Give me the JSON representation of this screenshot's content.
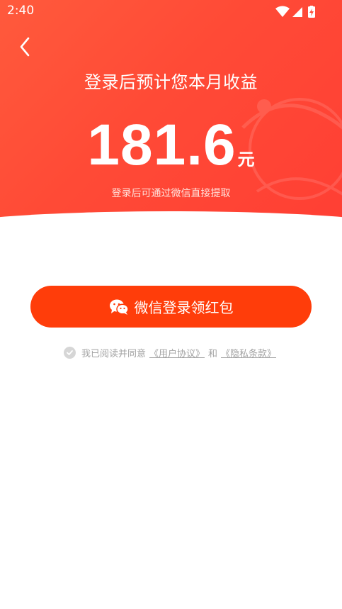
{
  "status_bar": {
    "time": "2:40"
  },
  "hero": {
    "headline": "登录后预计您本月收益",
    "amount": "181.6",
    "unit": "元",
    "subtext": "登录后可通过微信直接提取"
  },
  "login_button": {
    "label": "微信登录领红包"
  },
  "agreement": {
    "prefix": "我已阅读并同意",
    "user_agreement": "《用户协议》",
    "conjunction": "和",
    "privacy_policy": "《隐私条款》"
  },
  "colors": {
    "hero_start": "#ff5a3c",
    "hero_end": "#ff3f34",
    "button": "#ff3d0a",
    "muted_text": "#a3a3a3"
  }
}
